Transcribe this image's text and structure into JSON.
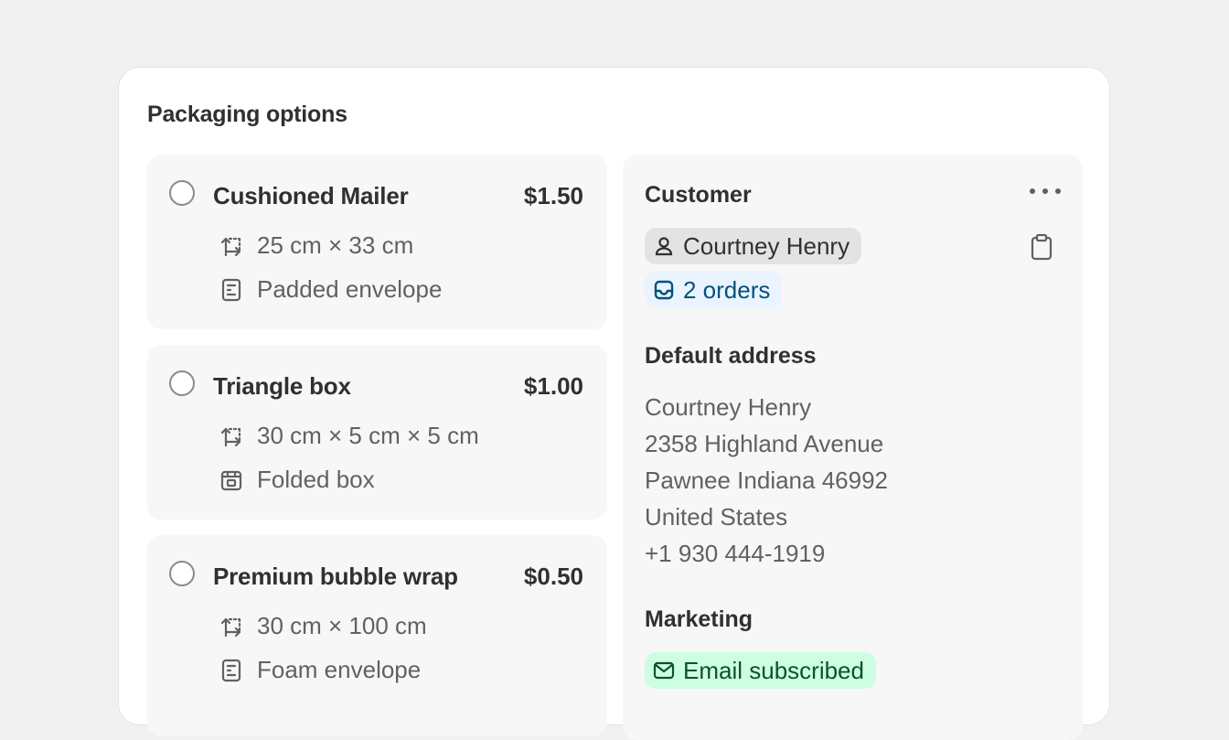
{
  "card": {
    "title": "Packaging options"
  },
  "options": [
    {
      "name": "Cushioned Mailer",
      "price": "$1.50",
      "dimensions": "25 cm × 33 cm",
      "type": "Padded envelope",
      "type_icon": "envelope-icon"
    },
    {
      "name": "Triangle box",
      "price": "$1.00",
      "dimensions": "30 cm × 5 cm × 5 cm",
      "type": "Folded box",
      "type_icon": "box-icon"
    },
    {
      "name": "Premium bubble wrap",
      "price": "$0.50",
      "dimensions": "30 cm × 100 cm",
      "type": "Foam envelope",
      "type_icon": "envelope-icon"
    }
  ],
  "customer": {
    "title": "Customer",
    "name": "Courtney Henry",
    "orders": "2 orders",
    "default_address_title": "Default address",
    "address_lines": [
      "Courtney Henry",
      "2358 Highland Avenue",
      "Pawnee Indiana 46992",
      "United States",
      "+1 930 444-1919"
    ],
    "marketing_title": "Marketing",
    "marketing_status": "Email subscribed"
  },
  "colors": {
    "background": "#f1f1f1",
    "card": "#ffffff",
    "option_bg": "#f7f7f7",
    "customer_chip": "#e3e3e3",
    "orders_chip": "#eaf4ff",
    "email_chip": "#cdfee1"
  }
}
